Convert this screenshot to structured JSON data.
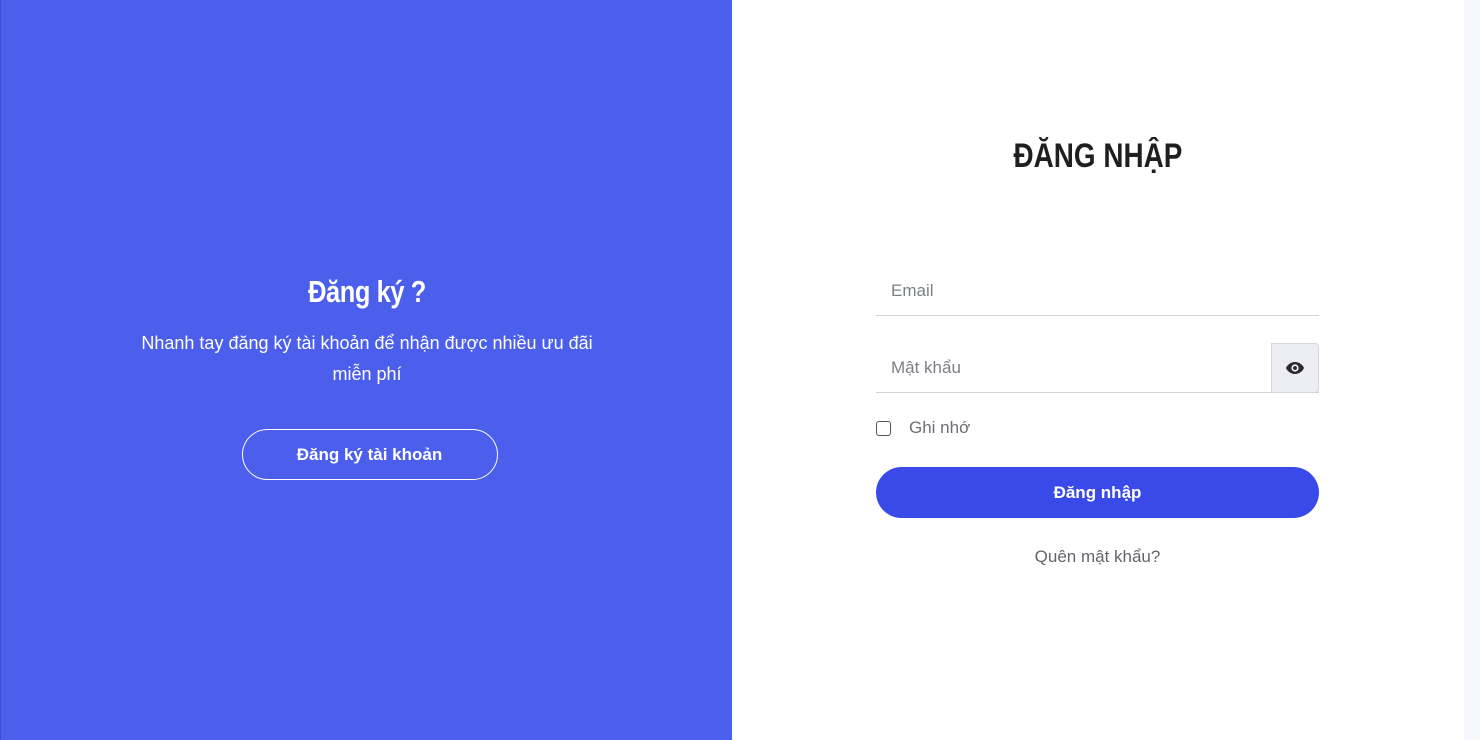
{
  "colors": {
    "promo_background": "#4b5eec",
    "primary_button": "#3a4ae8",
    "title_text": "#1f1f1f"
  },
  "promo": {
    "title": "Đăng ký ?",
    "description": "Nhanh tay đăng ký tài khoản để nhận được nhiều ưu đãi miễn phí",
    "register_button_label": "Đăng ký tài khoản"
  },
  "login": {
    "title": "ĐĂNG NHẬP",
    "email_placeholder": "Email",
    "email_value": "",
    "password_placeholder": "Mật khẩu",
    "password_value": "",
    "toggle_password_icon": "eye-icon",
    "remember_label": "Ghi nhớ",
    "remember_checked": false,
    "submit_label": "Đăng nhập",
    "forgot_label": "Quên mật khẩu?"
  }
}
